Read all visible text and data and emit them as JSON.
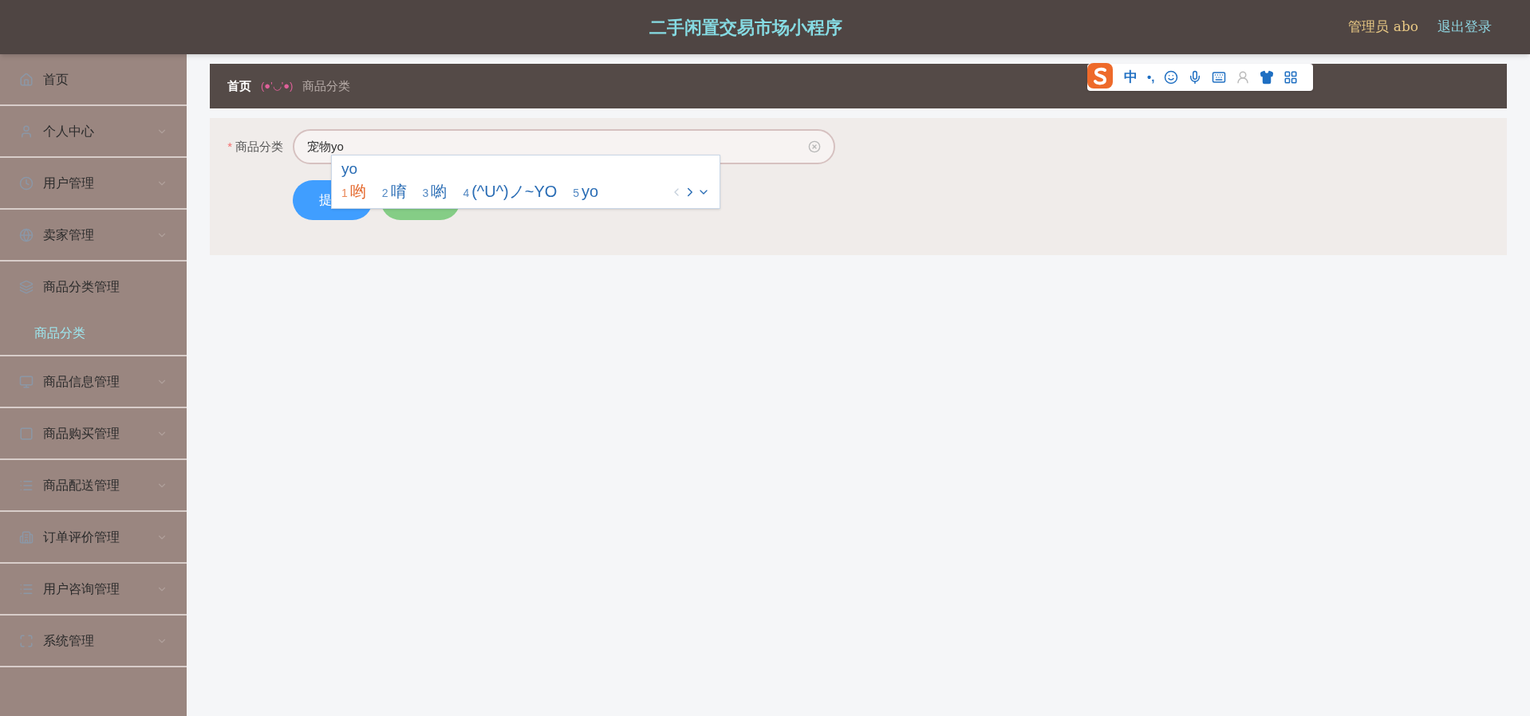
{
  "header": {
    "title": "二手闲置交易市场小程序",
    "user": "管理员 abo",
    "logout": "退出登录"
  },
  "sidebar": {
    "items": [
      {
        "label": "首页"
      },
      {
        "label": "个人中心",
        "expanded": false
      },
      {
        "label": "用户管理",
        "expanded": false
      },
      {
        "label": "卖家管理",
        "expanded": false
      },
      {
        "label": "商品分类管理",
        "expanded": true,
        "children": [
          {
            "label": "商品分类",
            "selected": true
          }
        ]
      },
      {
        "label": "商品信息管理",
        "expanded": false
      },
      {
        "label": "商品购买管理",
        "expanded": false
      },
      {
        "label": "商品配送管理",
        "expanded": false
      },
      {
        "label": "订单评价管理",
        "expanded": false
      },
      {
        "label": "用户咨询管理",
        "expanded": false
      },
      {
        "label": "系统管理",
        "expanded": false
      }
    ]
  },
  "breadcrumb": {
    "home": "首页",
    "separator": "(●'◡'●)",
    "current": "商品分类"
  },
  "form": {
    "field": {
      "label": "商品分类",
      "required_mark": "*",
      "value": "宠物yo"
    },
    "buttons": [
      {
        "label": "提",
        "kind": "primary"
      },
      {
        "kind": "success"
      }
    ]
  },
  "ime": {
    "composition": "yo",
    "candidates": [
      {
        "index": "1",
        "text": "哟",
        "selected": true
      },
      {
        "index": "2",
        "text": "唷",
        "selected": false
      },
      {
        "index": "3",
        "text": "喲",
        "selected": false
      },
      {
        "index": "4",
        "text": "(^U^)ノ~YO",
        "selected": false
      },
      {
        "index": "5",
        "text": "yo",
        "selected": false
      }
    ],
    "toolbar": {
      "lang": "中",
      "punct": "•,"
    }
  }
}
